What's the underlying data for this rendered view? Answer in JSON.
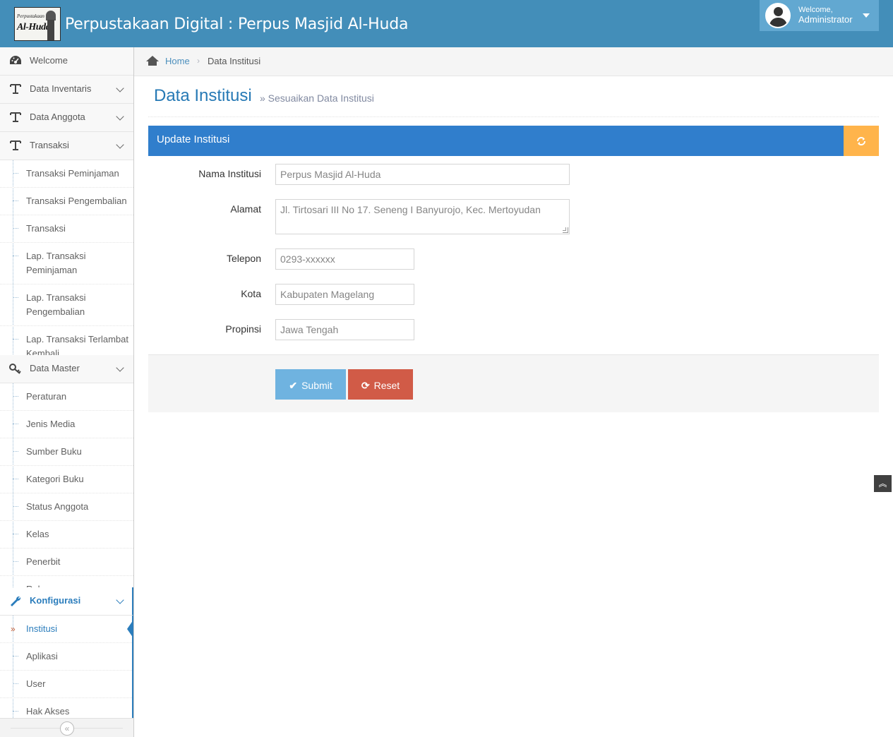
{
  "header": {
    "logo_text_small": "Perpustakaan",
    "logo_text_big": "Al-Huda",
    "title": "Perpustakaan Digital : Perpus Masjid Al-Huda",
    "welcome": "Welcome,",
    "user_name": "Administrator"
  },
  "sidebar": {
    "welcome": "Welcome",
    "inventaris": "Data Inventaris",
    "anggota": "Data Anggota",
    "transaksi": "Transaksi",
    "transaksi_sub": [
      "Transaksi Peminjaman",
      "Transaksi Pengembalian",
      "Transaksi",
      "Lap. Transaksi Peminjaman",
      "Lap. Transaksi Pengembalian",
      "Lap. Transaksi Terlambat Kembali"
    ],
    "master": "Data Master",
    "master_sub": [
      "Peraturan",
      "Jenis Media",
      "Sumber Buku",
      "Kategori Buku",
      "Status Anggota",
      "Kelas",
      "Penerbit",
      "Rak"
    ],
    "konfigurasi": "Konfigurasi",
    "konfigurasi_sub": [
      "Institusi",
      "Aplikasi",
      "User",
      "Hak Akses"
    ]
  },
  "breadcrumb": {
    "home": "Home",
    "current": "Data Institusi"
  },
  "page": {
    "title": "Data Institusi",
    "subtitle": "» Sesuaikan Data Institusi"
  },
  "panel": {
    "title": "Update Institusi"
  },
  "form": {
    "nama_label": "Nama Institusi",
    "nama_value": "Perpus Masjid Al-Huda",
    "alamat_label": "Alamat",
    "alamat_value": "Jl. Tirtosari III No 17. Seneng I Banyurojo, Kec. Mertoyudan",
    "telepon_label": "Telepon",
    "telepon_value": "0293-xxxxxx",
    "kota_label": "Kota",
    "kota_value": "Kabupaten Magelang",
    "propinsi_label": "Propinsi",
    "propinsi_value": "Jawa Tengah",
    "submit": "Submit",
    "reset": "Reset"
  },
  "icons": {
    "welcome": "tachometer-icon",
    "menu": "text-height-icon",
    "master": "key-icon",
    "konfigurasi": "wrench-icon",
    "refresh": "refresh-icon",
    "submit": "check-icon",
    "scroll_top": "double-angle-up-icon"
  },
  "colors": {
    "navbar": "#438eb9",
    "panel_header": "#307ecc",
    "refresh_button": "#ffb44b",
    "submit_button": "#6fb3e0",
    "reset_button": "#d15b47",
    "active_link": "#2b7dbc"
  }
}
